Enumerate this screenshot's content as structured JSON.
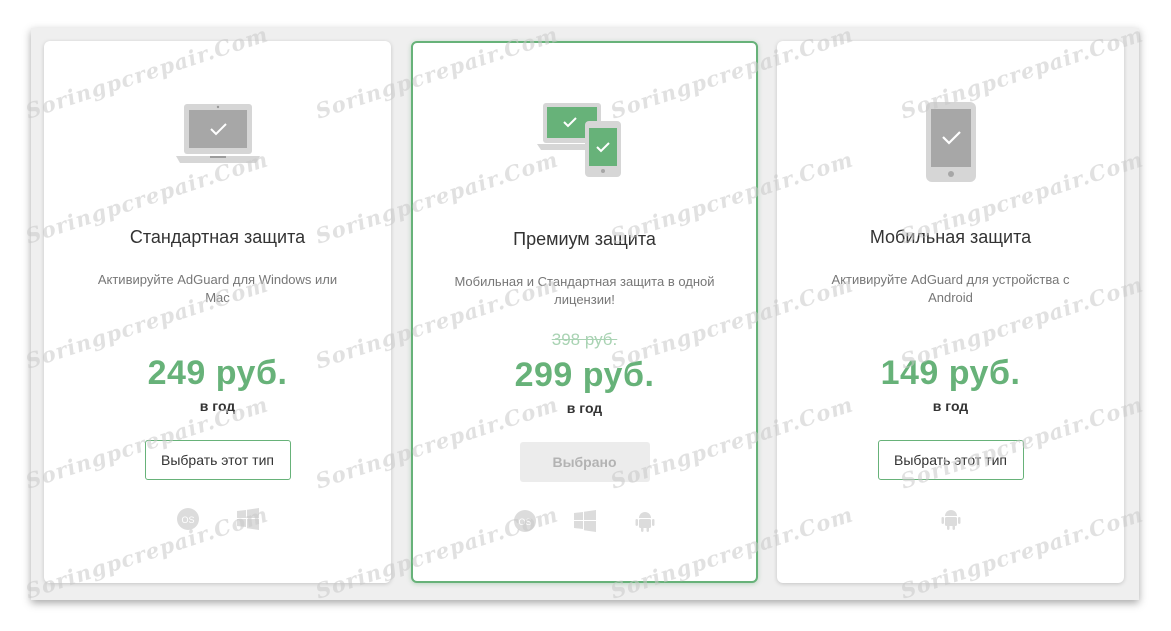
{
  "cards": [
    {
      "title": "Стандартная защита",
      "description": "Активируйте AdGuard для Windows или Mac",
      "old_price": "",
      "price": "249 руб.",
      "period": "в год",
      "button_label": "Выбрать этот тип",
      "platforms": [
        "macos-icon",
        "windows-icon"
      ]
    },
    {
      "title": "Премиум защита",
      "description": "Мобильная и Стандартная защита в одной лицензии!",
      "old_price": "398 руб.",
      "price": "299 руб.",
      "period": "в год",
      "button_label": "Выбрано",
      "selected": true,
      "platforms": [
        "macos-icon",
        "windows-icon",
        "android-icon"
      ]
    },
    {
      "title": "Мобильная защита",
      "description": "Активируйте AdGuard для устройства с Android",
      "old_price": "",
      "price": "149 руб.",
      "period": "в год",
      "button_label": "Выбрать этот тип",
      "platforms": [
        "android-icon"
      ]
    }
  ],
  "watermark": "Soringpcrepair.Com",
  "colors": {
    "accent": "#67b279",
    "old_price": "#a9d3b3",
    "device_gray": "#b8b8b8",
    "selected_button_bg": "#ececec"
  }
}
